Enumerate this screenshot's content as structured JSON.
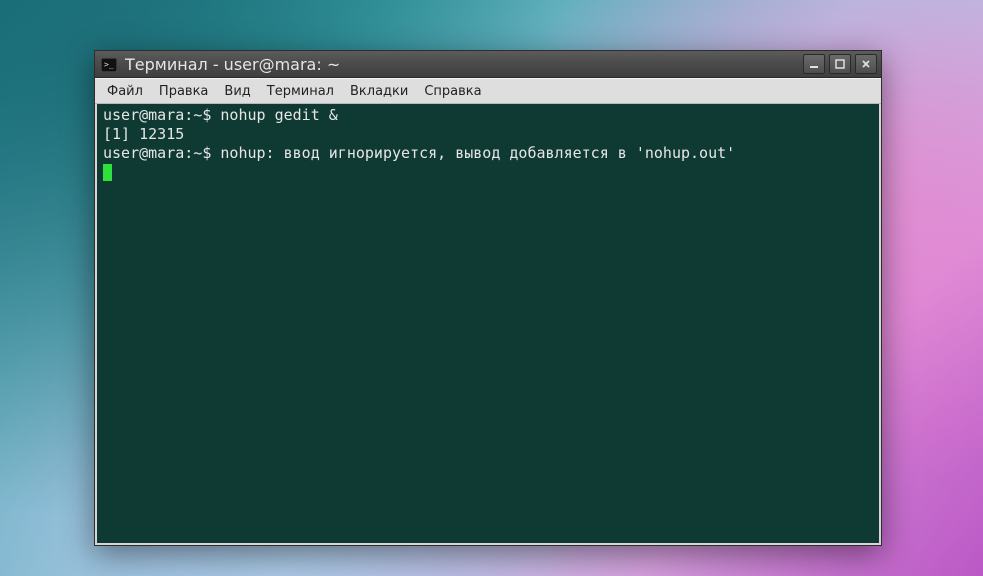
{
  "window": {
    "title": "Терминал - user@mara: ~"
  },
  "menubar": {
    "items": [
      "Файл",
      "Правка",
      "Вид",
      "Терминал",
      "Вкладки",
      "Справка"
    ]
  },
  "terminal": {
    "lines": [
      {
        "prompt": "user@mara:~$ ",
        "text": "nohup gedit &"
      },
      {
        "prompt": "",
        "text": "[1] 12315"
      },
      {
        "prompt": "user@mara:~$ ",
        "text": "nohup: ввод игнорируется, вывод добавляется в 'nohup.out'"
      }
    ]
  },
  "colors": {
    "terminal_bg": "#0f3a33",
    "terminal_fg": "#e6e6e6",
    "cursor": "#2fe23b",
    "titlebar_bg": "#4a4a4a",
    "menubar_bg": "#dedede"
  }
}
